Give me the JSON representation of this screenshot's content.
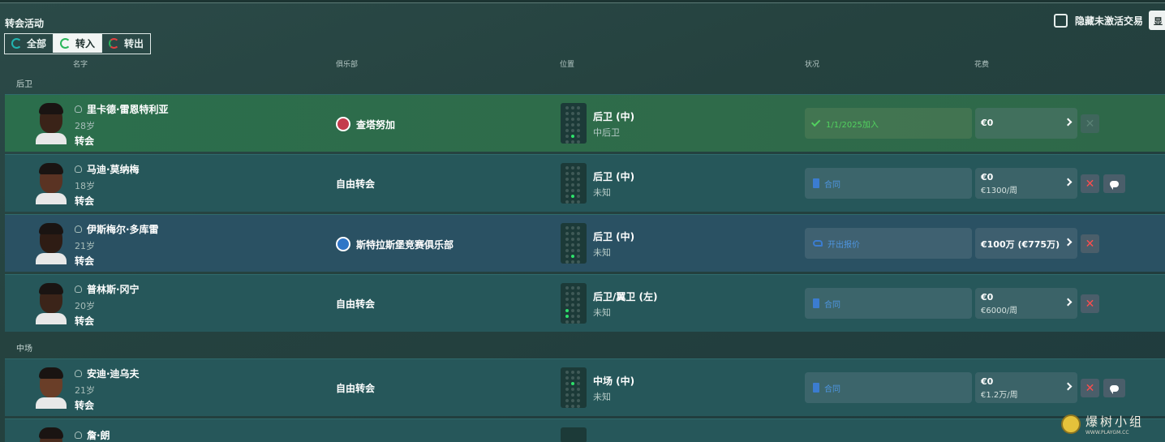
{
  "title": "转会活动",
  "filters": [
    {
      "label": "全部",
      "icon": "cycle-icon"
    },
    {
      "label": "转入",
      "icon": "cycle-in-icon",
      "active": true
    },
    {
      "label": "转出",
      "icon": "cycle-out-icon"
    }
  ],
  "hide_inactive_label": "隐藏未激活交易",
  "show_button_label": "显",
  "columns": {
    "name": "名字",
    "club": "俱乐部",
    "position": "位置",
    "status": "状况",
    "fee": "花费"
  },
  "sections": {
    "defenders": "后卫",
    "midfield": "中场"
  },
  "players": [
    {
      "name": "里卡德·雷恩特利亚",
      "age": "28岁",
      "type": "转会",
      "club": "查塔努加",
      "club_badge": "red",
      "position": "后卫 (中)",
      "position_sub": "中后卫",
      "status": "1/1/2025加入",
      "status_kind": "joined",
      "fee": "€0",
      "fee_sub": ""
    },
    {
      "name": "马迪·莫纳梅",
      "age": "18岁",
      "type": "转会",
      "club": "自由转会",
      "club_badge": "",
      "position": "后卫 (中)",
      "position_sub": "未知",
      "status": "合同",
      "status_kind": "contract",
      "fee": "€0",
      "fee_sub": "€1300/周"
    },
    {
      "name": "伊斯梅尔·多库雷",
      "age": "21岁",
      "type": "转会",
      "club": "斯特拉斯堡竞赛俱乐部",
      "club_badge": "blue",
      "position": "后卫 (中)",
      "position_sub": "未知",
      "status": "开出报价",
      "status_kind": "offer",
      "fee": "€100万 (€775万)",
      "fee_sub": ""
    },
    {
      "name": "普林斯·冈宁",
      "age": "20岁",
      "type": "转会",
      "club": "自由转会",
      "club_badge": "",
      "position": "后卫/翼卫 (左)",
      "position_sub": "未知",
      "status": "合同",
      "status_kind": "contract",
      "fee": "€0",
      "fee_sub": "€6000/周"
    },
    {
      "name": "安迪·迪乌夫",
      "age": "21岁",
      "type": "转会",
      "club": "自由转会",
      "club_badge": "",
      "position": "中场 (中)",
      "position_sub": "未知",
      "status": "合同",
      "status_kind": "contract",
      "fee": "€0",
      "fee_sub": "€1.2万/周"
    },
    {
      "name": "詹·朗"
    }
  ],
  "watermark": {
    "title": "爆树小组",
    "url": "WWW.PLAYGM.CC"
  },
  "colors": {
    "accent_green": "#52d25f",
    "accent_blue": "#4e95e0",
    "danger_red": "#ff4d4d"
  }
}
